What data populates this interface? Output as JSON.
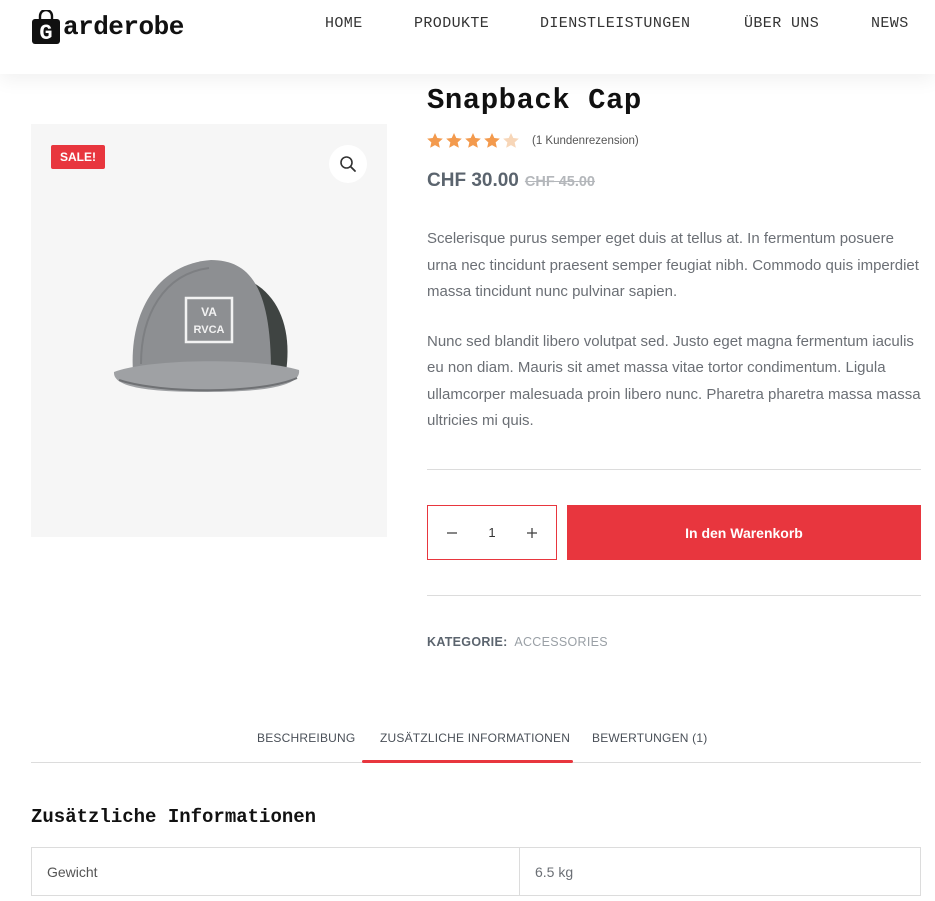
{
  "header": {
    "logo_letter": "G",
    "logo_text": "arderobe",
    "nav": [
      "HOME",
      "PRODUKTE",
      "DIENSTLEISTUNGEN",
      "ÜBER UNS",
      "NEWS"
    ]
  },
  "product": {
    "sale_badge": "SALE!",
    "title": "Snapback Cap",
    "rating": 4,
    "rating_max": 5,
    "reviews_text": "(1 Kundenrezension)",
    "price_current": "CHF 30.00",
    "price_old": "CHF 45.00",
    "description": [
      "Scelerisque purus semper eget duis at tellus at. In fermentum posuere urna nec tincidunt praesent semper feugiat nibh. Commodo quis imperdiet massa tincidunt nunc pulvinar sapien.",
      "Nunc sed blandit libero volutpat sed. Justo eget magna fermentum iaculis eu non diam. Mauris sit amet massa vitae tortor condimentum. Ligula ullamcorper malesuada proin libero nunc. Pharetra pharetra massa massa ultricies mi quis."
    ],
    "quantity": "1",
    "add_to_cart": "In den Warenkorb",
    "category_label": "KATEGORIE:",
    "category_value": "ACCESSORIES",
    "cap_logo_top": "VA",
    "cap_logo_bottom": "RVCA"
  },
  "tabs": {
    "items": [
      "BESCHREIBUNG",
      "ZUSÄTZLICHE INFORMATIONEN",
      "BEWERTUNGEN (1)"
    ],
    "active": 1
  },
  "additional_info": {
    "title": "Zusätzliche Informationen",
    "rows": [
      {
        "label": "Gewicht",
        "value": "6.5 kg"
      }
    ]
  },
  "colors": {
    "accent": "#e8363e",
    "star": "#f39a4d",
    "star_empty": "#f7d6b8"
  }
}
